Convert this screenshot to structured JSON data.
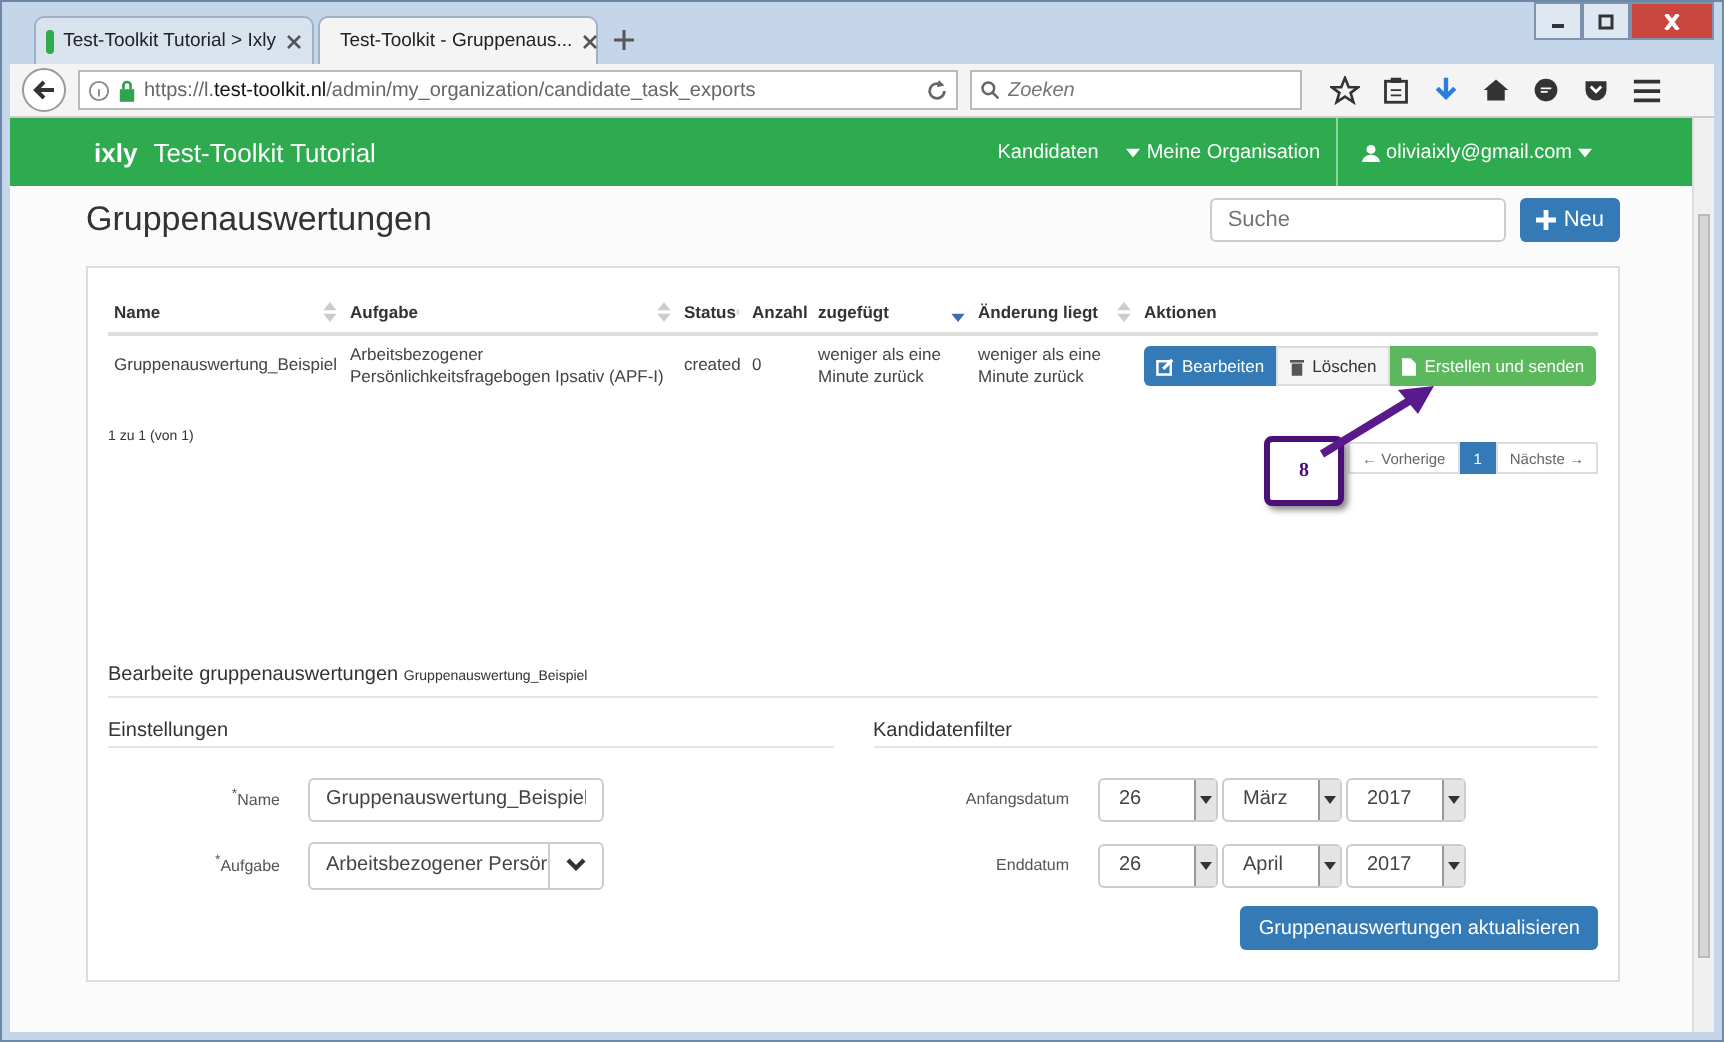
{
  "browser": {
    "tabs": [
      {
        "title": "Test-Toolkit Tutorial > Ixly",
        "selected": false
      },
      {
        "title": "Test-Toolkit - Gruppenaus...",
        "selected": true
      }
    ],
    "url": {
      "prefix": "https://l.",
      "domain": "test-toolkit.nl",
      "path": "/admin/my_organization/candidate_task_exports"
    },
    "search_placeholder": "Zoeken"
  },
  "navbar": {
    "logo": "ixly",
    "title": "Test-Toolkit Tutorial",
    "links": [
      {
        "label": "Kandidaten",
        "caret": false
      },
      {
        "label": "Meine Organisation",
        "caret": true
      }
    ],
    "user": "oliviaixly@gmail.com"
  },
  "page": {
    "title": "Gruppenauswertungen",
    "search_placeholder": "Suche",
    "new_button": "Neu"
  },
  "table": {
    "columns": [
      {
        "label": "Name",
        "sortable": true,
        "sorted": false
      },
      {
        "label": "Aufgabe",
        "sortable": true,
        "sorted": false
      },
      {
        "label": "Status",
        "sortable": true,
        "sorted": false
      },
      {
        "label": "Anzahl",
        "sortable": false
      },
      {
        "label": "zugefügt",
        "sortable": true,
        "sorted": true
      },
      {
        "label": "Änderung liegt",
        "sortable": true,
        "sorted": false
      },
      {
        "label": "Aktionen",
        "sortable": false
      }
    ],
    "rows": [
      {
        "cells": [
          "Gruppenauswertung_Beispiel",
          "Arbeitsbezogener Persönlichkeitsfragebogen Ipsativ (APF-I)",
          "created",
          "0",
          "weniger als eine Minute zurück",
          "weniger als eine Minute zurück"
        ],
        "actions": [
          {
            "label": "Bearbeiten",
            "kind": "edit"
          },
          {
            "label": "Löschen",
            "kind": "delete"
          },
          {
            "label": "Erstellen und senden",
            "kind": "send"
          }
        ]
      }
    ],
    "info": "1 zu 1 (von 1)",
    "pager": [
      {
        "label": "← Vorherige",
        "selected": false
      },
      {
        "label": "1",
        "selected": true
      },
      {
        "label": "Nächste →",
        "selected": false
      }
    ]
  },
  "annotation": "8",
  "edit": {
    "title": "Bearbeite gruppenauswertungen",
    "subtitle": "Gruppenauswertung_Beispiel",
    "settings": {
      "title": "Einstellungen",
      "fields": [
        {
          "label": "Name",
          "required_mark": "*",
          "kind": "text",
          "value": "Gruppenauswertung_Beispiel"
        },
        {
          "label": "Aufgabe",
          "required_mark": "*",
          "kind": "select",
          "value": "Arbeitsbezogener Persör"
        }
      ]
    },
    "filter": {
      "title": "Kandidatenfilter",
      "dates": [
        {
          "label": "Anfangsdatum",
          "day": "26",
          "month": "März",
          "year": "2017"
        },
        {
          "label": "Enddatum",
          "day": "26",
          "month": "April",
          "year": "2017"
        }
      ]
    },
    "submit": "Gruppenauswertungen aktualisieren"
  }
}
